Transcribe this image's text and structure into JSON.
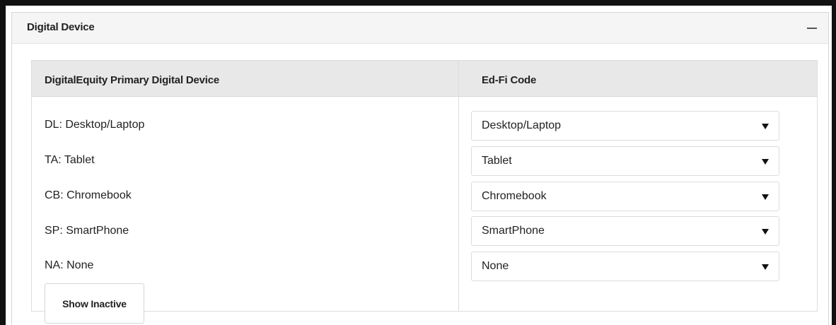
{
  "panel": {
    "title": "Digital Device"
  },
  "table": {
    "col_left_header": "DigitalEquity Primary Digital Device",
    "col_right_header": "Ed-Fi Code",
    "rows": [
      {
        "label": "DL: Desktop/Laptop",
        "value": "Desktop/Laptop"
      },
      {
        "label": "TA: Tablet",
        "value": "Tablet"
      },
      {
        "label": "CB: Chromebook",
        "value": "Chromebook"
      },
      {
        "label": "SP: SmartPhone",
        "value": "SmartPhone"
      },
      {
        "label": "NA: None",
        "value": "None"
      }
    ]
  },
  "actions": {
    "show_inactive_label": "Show Inactive"
  },
  "icons": {
    "collapse": "minus-icon",
    "dropdown": "caret-down-icon"
  },
  "colors": {
    "header_bg": "#f5f5f5",
    "table_header_bg": "#e8e8e8",
    "border": "#dddddd"
  }
}
